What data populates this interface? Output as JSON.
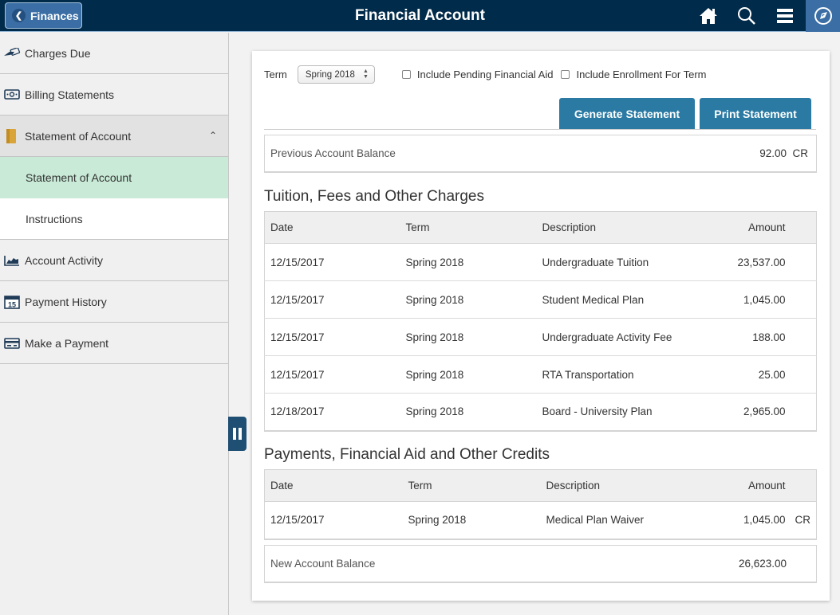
{
  "header": {
    "back_label": "Finances",
    "title": "Financial Account",
    "icons": [
      "home-icon",
      "search-icon",
      "menu-icon",
      "navigator-icon"
    ]
  },
  "sidebar": {
    "items": [
      {
        "label": "Charges Due",
        "icon": "hand-money-icon"
      },
      {
        "label": "Billing Statements",
        "icon": "banknote-icon"
      },
      {
        "label": "Statement of Account",
        "icon": "folder-icon",
        "expanded": true,
        "children": [
          {
            "label": "Statement of Account",
            "active": true
          },
          {
            "label": "Instructions"
          }
        ]
      },
      {
        "label": "Account Activity",
        "icon": "area-chart-icon"
      },
      {
        "label": "Payment History",
        "icon": "calendar-icon",
        "icon_text": "15"
      },
      {
        "label": "Make a Payment",
        "icon": "credit-card-icon"
      }
    ]
  },
  "filters": {
    "term_label": "Term",
    "term_value": "Spring 2018",
    "pending_aid_label": "Include Pending Financial Aid",
    "pending_aid_checked": false,
    "enrollment_label": "Include Enrollment For Term",
    "enrollment_checked": false
  },
  "actions": {
    "generate_label": "Generate Statement",
    "print_label": "Print Statement"
  },
  "previous_balance": {
    "label": "Previous Account Balance",
    "amount": "92.00",
    "suffix": "CR"
  },
  "charges": {
    "title": "Tuition, Fees and Other Charges",
    "columns": [
      "Date",
      "Term",
      "Description",
      "Amount"
    ],
    "rows": [
      {
        "date": "12/15/2017",
        "term": "Spring 2018",
        "description": "Undergraduate Tuition",
        "amount": "23,537.00"
      },
      {
        "date": "12/15/2017",
        "term": "Spring 2018",
        "description": "Student Medical Plan",
        "amount": "1,045.00"
      },
      {
        "date": "12/15/2017",
        "term": "Spring 2018",
        "description": "Undergraduate Activity Fee",
        "amount": "188.00"
      },
      {
        "date": "12/15/2017",
        "term": "Spring 2018",
        "description": "RTA Transportation",
        "amount": "25.00"
      },
      {
        "date": "12/18/2017",
        "term": "Spring 2018",
        "description": "Board - University Plan",
        "amount": "2,965.00"
      }
    ]
  },
  "credits": {
    "title": "Payments, Financial Aid and Other Credits",
    "columns": [
      "Date",
      "Term",
      "Description",
      "Amount"
    ],
    "rows": [
      {
        "date": "12/15/2017",
        "term": "Spring 2018",
        "description": "Medical Plan Waiver",
        "amount": "1,045.00",
        "suffix": "CR"
      }
    ]
  },
  "new_balance": {
    "label": "New Account Balance",
    "amount": "26,623.00"
  },
  "colors": {
    "header_bg": "#012b4a",
    "accent_button": "#2a7aa3",
    "active_nav": "#c8ead6"
  }
}
